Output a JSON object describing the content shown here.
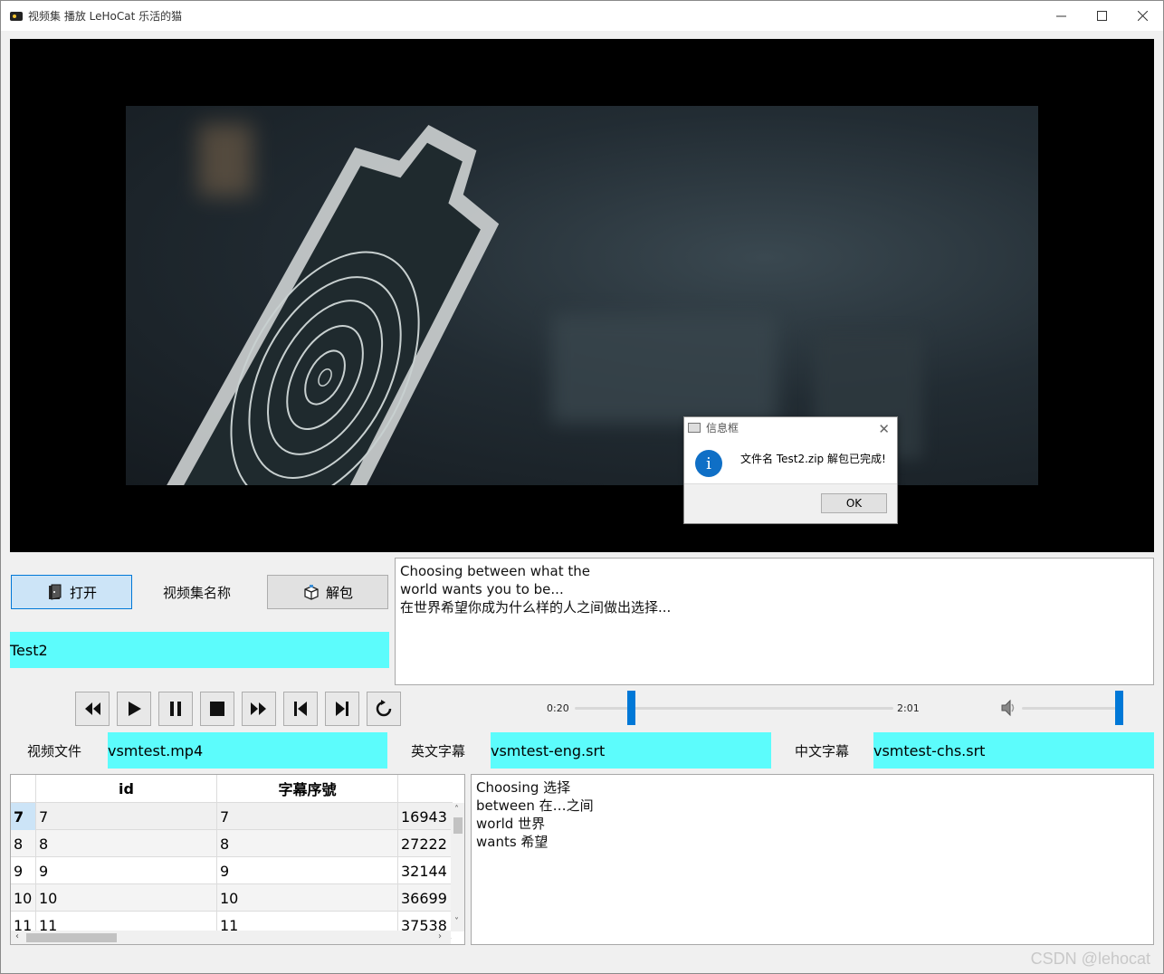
{
  "window": {
    "title": "视频集 播放  LeHoCat 乐活的猫"
  },
  "dialog": {
    "title": "信息框",
    "message": "文件名 Test2.zip 解包已完成!",
    "ok_label": "OK"
  },
  "top_controls": {
    "open_label": "打开",
    "collection_name_label": "视频集名称",
    "unpack_label": "解包",
    "collection_name_value": "Test2"
  },
  "subtitle_display": "Choosing between what the\nworld wants you to be...\n在世界希望你成为什么样的人之间做出选择...",
  "playback": {
    "buttons": [
      "rewind-icon",
      "play-icon",
      "pause-icon",
      "stop-icon",
      "fast-forward-icon",
      "step-back-icon",
      "step-forward-icon",
      "replay-icon"
    ],
    "current_time": "0:20",
    "total_time": "2:01",
    "progress": 0.17,
    "volume": 1.0
  },
  "files": {
    "video_label": "视频文件",
    "video_value": "vsmtest.mp4",
    "english_label": "英文字幕",
    "english_value": "vsmtest-eng.srt",
    "chinese_label": "中文字幕",
    "chinese_value": "vsmtest-chs.srt"
  },
  "table": {
    "columns": [
      "id",
      "字幕序號"
    ],
    "rows": [
      {
        "header": "7",
        "id": "7",
        "seq": "7",
        "extra": "16943"
      },
      {
        "header": "8",
        "id": "8",
        "seq": "8",
        "extra": "27222"
      },
      {
        "header": "9",
        "id": "9",
        "seq": "9",
        "extra": "32144"
      },
      {
        "header": "10",
        "id": "10",
        "seq": "10",
        "extra": "36699"
      },
      {
        "header": "11",
        "id": "11",
        "seq": "11",
        "extra": "37538"
      }
    ]
  },
  "word_panel": "Choosing 选择\nbetween 在…之间\nworld 世界\nwants 希望",
  "watermark": "CSDN @lehocat"
}
